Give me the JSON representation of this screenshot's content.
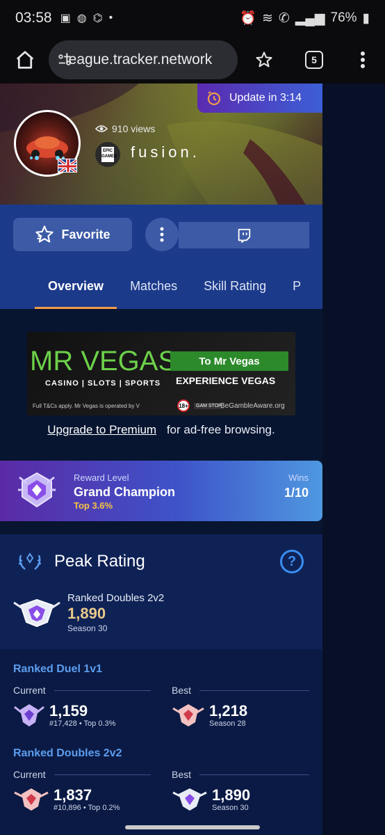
{
  "status": {
    "time": "03:58",
    "battery": "76%"
  },
  "browser": {
    "url": "league.tracker.network",
    "tab_count": "5"
  },
  "hero": {
    "update_label": "Update in 3:14",
    "views": "910 views",
    "username": "fusion.",
    "platform_badge": "EPIC GAMES"
  },
  "actions": {
    "favorite_label": "Favorite"
  },
  "tabs": [
    {
      "label": "Overview"
    },
    {
      "label": "Matches"
    },
    {
      "label": "Skill Rating"
    },
    {
      "label": "P"
    }
  ],
  "ad": {
    "brand": "MR VEGAS",
    "subtitle": "CASINO | SLOTS | SPORTS",
    "cta": "To Mr Vegas",
    "tagline": "EXPERIENCE VEGAS",
    "fineprint": "Full T&Cs apply. Mr Vegas is operated by V",
    "age": "18+",
    "gamstop": "GAM STOP",
    "begamble": "BeGambleAware.org"
  },
  "upgrade": {
    "link": "Upgrade to Premium",
    "text": "for ad-free browsing."
  },
  "reward": {
    "label": "Reward Level",
    "name": "Grand Champion",
    "top": "Top 3.6%",
    "wins_label": "Wins",
    "wins_value": "1/10"
  },
  "peak": {
    "title": "Peak Rating",
    "help": "?",
    "playlist": "Ranked Doubles 2v2",
    "value": "1,890",
    "season": "Season 30"
  },
  "playlists": [
    {
      "title": "Ranked Duel 1v1",
      "current": {
        "label": "Current",
        "value": "1,159",
        "sub": "#17,428 • Top 0.3%"
      },
      "best": {
        "label": "Best",
        "value": "1,218",
        "sub": "Season 28"
      }
    },
    {
      "title": "Ranked Doubles 2v2",
      "current": {
        "label": "Current",
        "value": "1,837",
        "sub": "#10,896 • Top 0.2%"
      },
      "best": {
        "label": "Best",
        "value": "1,890",
        "sub": "Season 30"
      }
    }
  ],
  "colors": {
    "accent": "#f39c4a",
    "link_blue": "#5c9dee",
    "gold": "#e7c98b",
    "panel": "#0f2256"
  }
}
